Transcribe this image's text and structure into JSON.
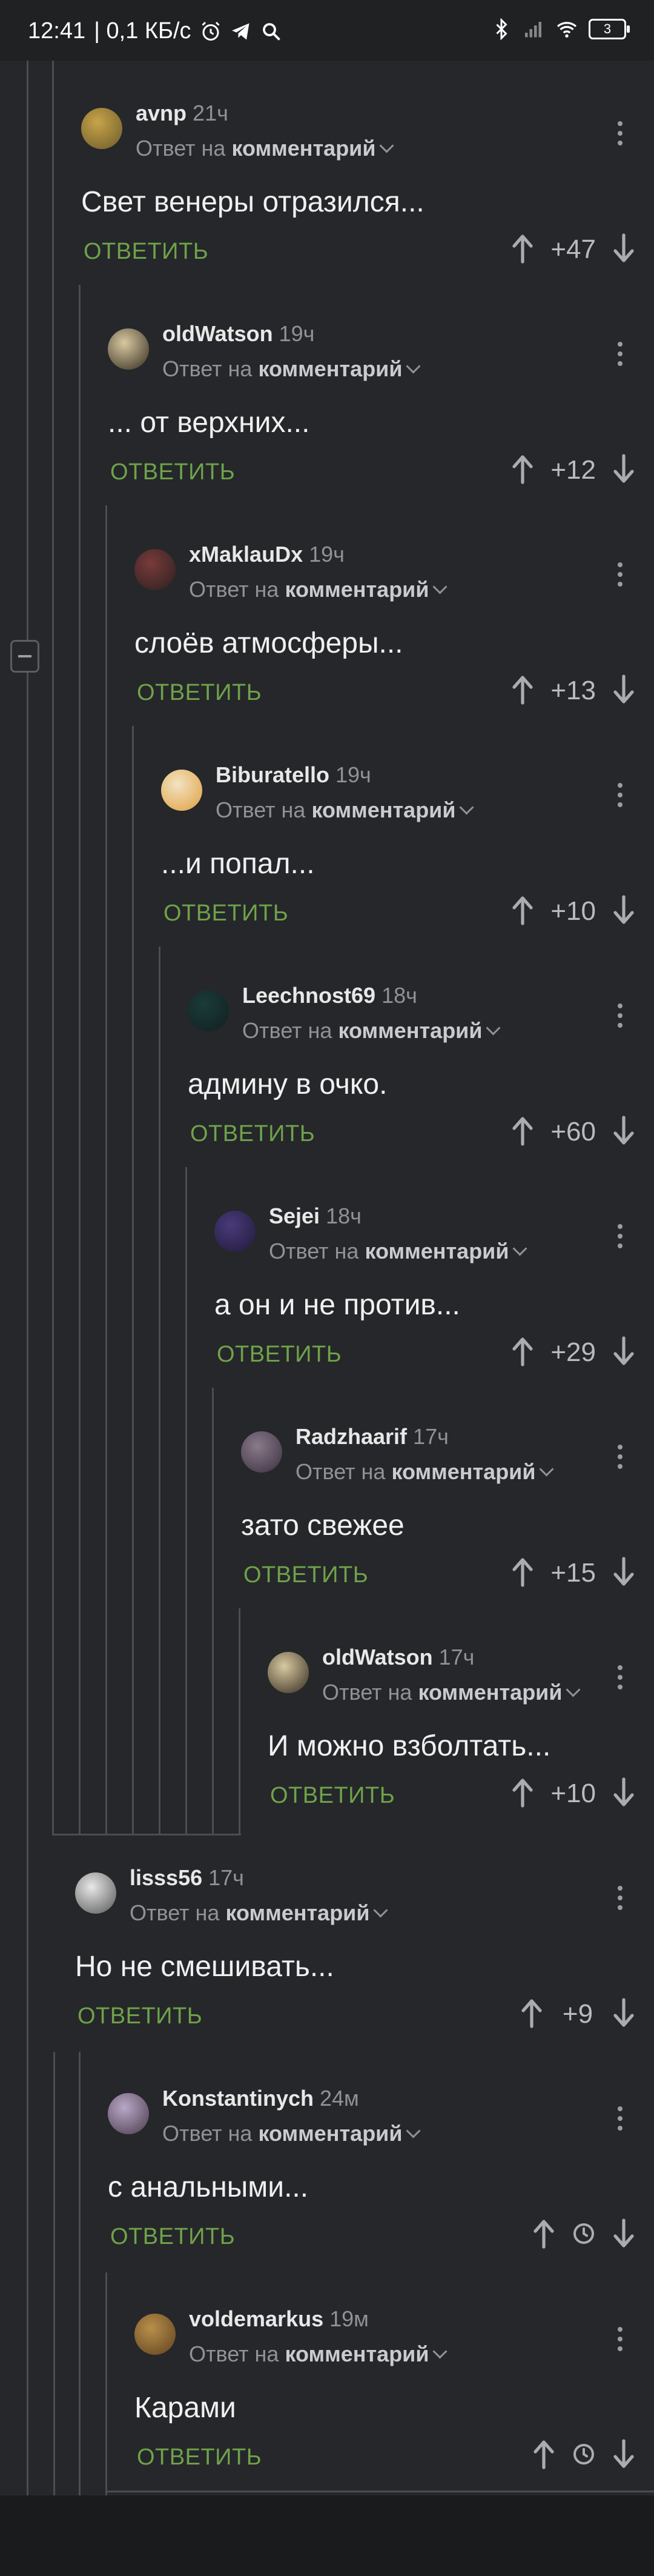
{
  "status_bar": {
    "time": "12:41",
    "network_speed": "| 0,1 КБ/с",
    "battery": "3",
    "icons": [
      "alarm-icon",
      "telegram-icon",
      "search-icon",
      "bluetooth-icon",
      "signal-icon",
      "wifi-icon",
      "battery-icon"
    ]
  },
  "labels": {
    "reply_to_prefix": "Ответ на",
    "reply_to_target": "комментарий",
    "reply_button": "ОТВЕТИТЬ"
  },
  "comments": [
    {
      "author": "avnp",
      "time": "21ч",
      "text": "Свет венеры отразился...",
      "score": "+47"
    },
    {
      "author": "oldWatson",
      "time": "19ч",
      "text": "... от верхних...",
      "score": "+12"
    },
    {
      "author": "xMaklauDx",
      "time": "19ч",
      "text": "слоёв атмосферы...",
      "score": "+13"
    },
    {
      "author": "Biburatello",
      "time": "19ч",
      "text": "...и попал...",
      "score": "+10"
    },
    {
      "author": "Leechnost69",
      "time": "18ч",
      "text": "админу в очко.",
      "score": "+60"
    },
    {
      "author": "Sejei",
      "time": "18ч",
      "text": "а он и не против...",
      "score": "+29"
    },
    {
      "author": "Radzhaarif",
      "time": "17ч",
      "text": "зато свежее",
      "score": "+15"
    },
    {
      "author": "oldWatson",
      "time": "17ч",
      "text": "И можно взболтать...",
      "score": "+10"
    },
    {
      "author": "lisss56",
      "time": "17ч",
      "text": "Но не смешивать...",
      "score": "+9"
    },
    {
      "author": "Konstantinych",
      "time": "24м",
      "text": "с анальными...",
      "score": ""
    },
    {
      "author": "voldemarkus",
      "time": "19м",
      "text": "Карами",
      "score": ""
    }
  ],
  "colors": {
    "background": "#25272a",
    "reply_button": "#6fa24a",
    "thread_line": "#4a4d51",
    "muted_text": "#8f9296"
  }
}
